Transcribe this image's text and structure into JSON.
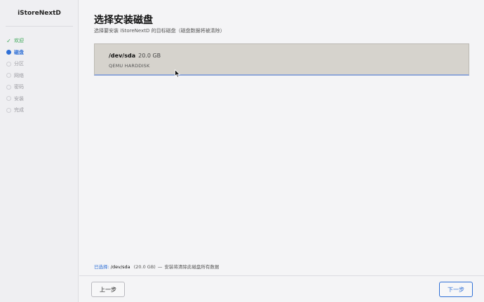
{
  "app": {
    "title": "iStoreNextD"
  },
  "steps": [
    {
      "label": "欢迎",
      "state": "done"
    },
    {
      "label": "磁盘",
      "state": "active"
    },
    {
      "label": "分区",
      "state": "pending"
    },
    {
      "label": "网络",
      "state": "pending"
    },
    {
      "label": "密码",
      "state": "pending"
    },
    {
      "label": "安装",
      "state": "pending"
    },
    {
      "label": "完成",
      "state": "pending"
    }
  ],
  "page": {
    "title": "选择安装磁盘",
    "subtitle": "选择要安装 iStoreNextD 的目标磁盘（磁盘数据将被清除）"
  },
  "disk": {
    "name": "/dev/sda",
    "size": "20.0 GB",
    "model": "QEMU HARDDISK"
  },
  "summary": {
    "label": "已选择:",
    "device": "/dev/sda",
    "size": "(20.0 GB)",
    "separator": "—",
    "warning": "安装将清除此磁盘所有数据"
  },
  "buttons": {
    "prev": "上一步",
    "next": "下一步"
  },
  "colors": {
    "accent": "#2e6fd6",
    "success": "#3aa655",
    "card": "#d6d3cd"
  }
}
